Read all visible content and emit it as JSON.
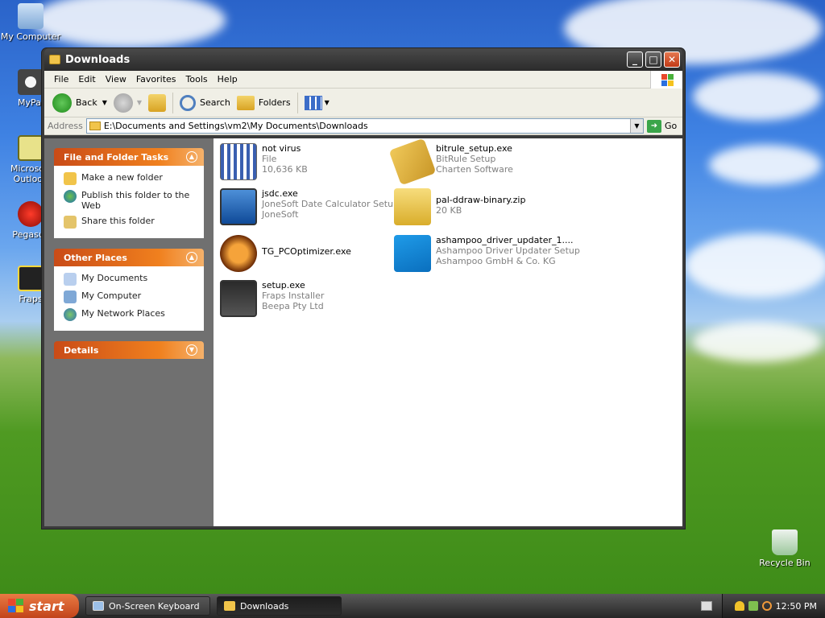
{
  "desktop": {
    "icons": [
      {
        "label": "My Computer"
      },
      {
        "label": "MyPal"
      },
      {
        "label": "Microsoft Outlook"
      },
      {
        "label": "Pegasus"
      },
      {
        "label": "Fraps"
      },
      {
        "label": "Recycle Bin"
      }
    ]
  },
  "window": {
    "title": "Downloads",
    "buttons": {
      "minimize": "_",
      "maximize": "□",
      "close": "✕"
    }
  },
  "menubar": {
    "items": [
      "File",
      "Edit",
      "View",
      "Favorites",
      "Tools",
      "Help"
    ]
  },
  "toolbar": {
    "back": "Back",
    "search": "Search",
    "folders": "Folders"
  },
  "addressbar": {
    "label": "Address",
    "path": "E:\\Documents and Settings\\vm2\\My Documents\\Downloads",
    "go": "Go"
  },
  "sidebar": {
    "file_tasks": {
      "title": "File and Folder Tasks",
      "items": [
        "Make a new folder",
        "Publish this folder to the Web",
        "Share this folder"
      ]
    },
    "other_places": {
      "title": "Other Places",
      "items": [
        "My Documents",
        "My Computer",
        "My Network Places"
      ]
    },
    "details": {
      "title": "Details"
    }
  },
  "files": [
    {
      "name": "not virus",
      "line2": "File",
      "line3": "10,636 KB"
    },
    {
      "name": "bitrule_setup.exe",
      "line2": "BitRule Setup",
      "line3": "Charten Software"
    },
    {
      "name": "jsdc.exe",
      "line2": "JoneSoft Date Calculator Setup",
      "line3": "JoneSoft"
    },
    {
      "name": "pal-ddraw-binary.zip",
      "line2": "20 KB",
      "line3": ""
    },
    {
      "name": "TG_PCOptimizer.exe",
      "line2": "",
      "line3": ""
    },
    {
      "name": "ashampoo_driver_updater_1....",
      "line2": "Ashampoo Driver Updater Setup",
      "line3": "Ashampoo GmbH & Co. KG"
    },
    {
      "name": "setup.exe",
      "line2": "Fraps Installer",
      "line3": "Beepa Pty Ltd"
    }
  ],
  "taskbar": {
    "start": "start",
    "tasks": [
      "On-Screen Keyboard",
      "Downloads"
    ],
    "clock": "12:50 PM"
  },
  "colors": {
    "accent_orange": "#e8701e",
    "titlebar_dark": "#2b2b2b",
    "sidebar_gray": "#707070"
  }
}
